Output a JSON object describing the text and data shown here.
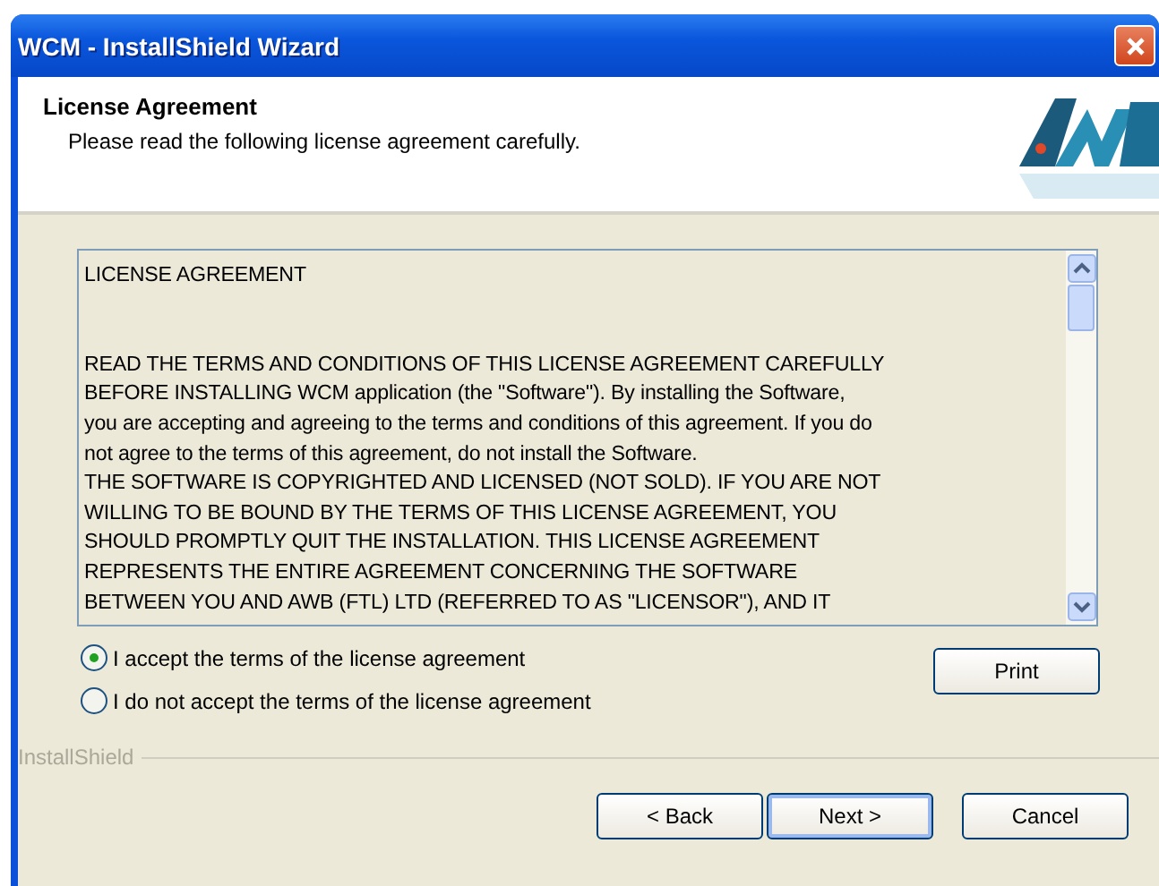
{
  "window": {
    "title": "WCM - InstallShield Wizard"
  },
  "header": {
    "title": "License Agreement",
    "subtitle": "Please read the following license agreement carefully."
  },
  "license_text": {
    "heading": "LICENSE AGREEMENT",
    "lines": [
      "READ THE TERMS AND CONDITIONS OF THIS LICENSE AGREEMENT CAREFULLY",
      "BEFORE INSTALLING WCM application  (the \"Software\").   By installing the Software,",
      "you are accepting and agreeing to the terms and conditions of this agreement. If you do",
      "not agree to the terms of this agreement, do not install the Software.",
      "THE SOFTWARE IS COPYRIGHTED AND LICENSED (NOT SOLD). IF YOU ARE NOT",
      "WILLING TO BE BOUND BY THE TERMS OF THIS LICENSE AGREEMENT, YOU",
      "SHOULD PROMPTLY QUIT THE INSTALLATION.  THIS LICENSE AGREEMENT",
      "REPRESENTS THE ENTIRE AGREEMENT CONCERNING THE SOFTWARE",
      "BETWEEN YOU AND AWB (FTL) LTD (REFERRED TO AS \"LICENSOR\"), AND IT"
    ]
  },
  "options": [
    {
      "label": "I accept the terms of the license agreement",
      "selected": true
    },
    {
      "label": "I do not accept the terms of the license agreement",
      "selected": false
    }
  ],
  "print_button": "Print",
  "brand_label": "InstallShield",
  "buttons": [
    {
      "label": "< Back",
      "default": false
    },
    {
      "label": "Next >",
      "default": true
    },
    {
      "label": "Cancel",
      "default": false
    }
  ]
}
